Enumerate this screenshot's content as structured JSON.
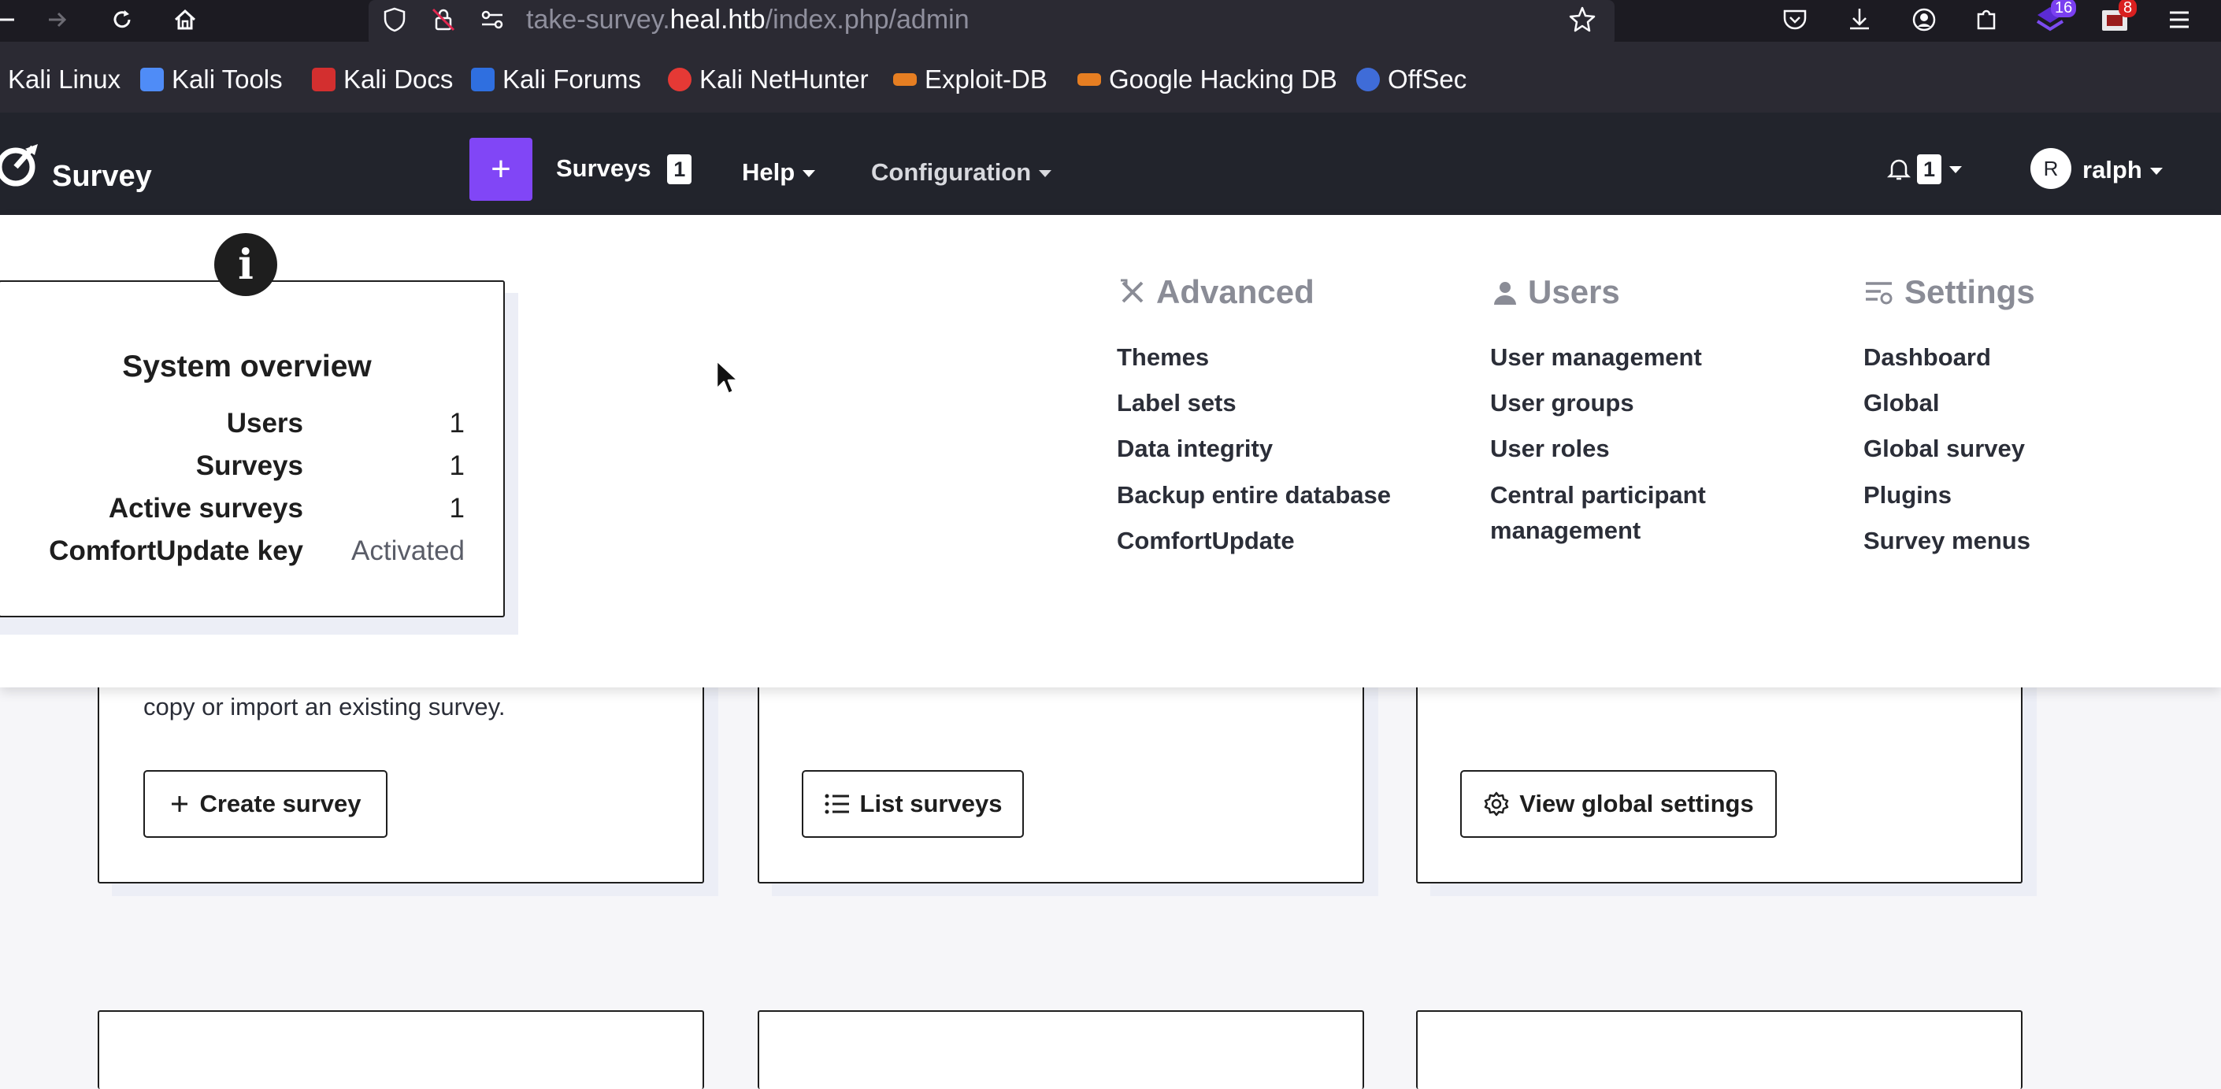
{
  "browser": {
    "url_prefix": "take-survey.",
    "url_host": "heal.htb",
    "url_path": "/index.php/admin",
    "extensions_badge": "16",
    "notify_badge": "8",
    "bookmarks": [
      {
        "label": "Kali Linux",
        "color": "#367bf0"
      },
      {
        "label": "Kali Tools",
        "color": "#4f8cf7"
      },
      {
        "label": "Kali Docs",
        "color": "#d32f2f"
      },
      {
        "label": "Kali Forums",
        "color": "#2f6fe0"
      },
      {
        "label": "Kali NetHunter",
        "color": "#e53935"
      },
      {
        "label": "Exploit-DB",
        "color": "#e67e22"
      },
      {
        "label": "Google Hacking DB",
        "color": "#e67e22"
      },
      {
        "label": "OffSec",
        "color": "#3f6cd8"
      }
    ]
  },
  "navbar": {
    "brand": "Survey",
    "add_label": "+",
    "surveys_label": "Surveys",
    "surveys_count": "1",
    "help_label": "Help",
    "configuration_label": "Configuration",
    "notifications_count": "1",
    "user_initial": "R",
    "user_name": "ralph",
    "accent_color": "#8146f6"
  },
  "menu": {
    "advanced": {
      "title": "Advanced",
      "items": [
        "Themes",
        "Label sets",
        "Data integrity",
        "Backup entire database",
        "ComfortUpdate"
      ]
    },
    "users": {
      "title": "Users",
      "items": [
        "User management",
        "User groups",
        "User roles",
        "Central participant",
        "management"
      ]
    },
    "settings": {
      "title": "Settings",
      "items": [
        "Dashboard",
        "Global",
        "Global survey",
        "Plugins",
        "Survey menus"
      ]
    }
  },
  "overview": {
    "info_icon": "i",
    "title": "System overview",
    "rows": [
      {
        "label": "Users",
        "value": "1"
      },
      {
        "label": "Surveys",
        "value": "1"
      },
      {
        "label": "Active surveys",
        "value": "1"
      },
      {
        "label": "ComfortUpdate key",
        "value": "Activated"
      }
    ]
  },
  "cards": {
    "create_text": "copy or import an existing survey.",
    "create_button": "Create survey",
    "list_button": "List surveys",
    "settings_button": "View global settings"
  }
}
